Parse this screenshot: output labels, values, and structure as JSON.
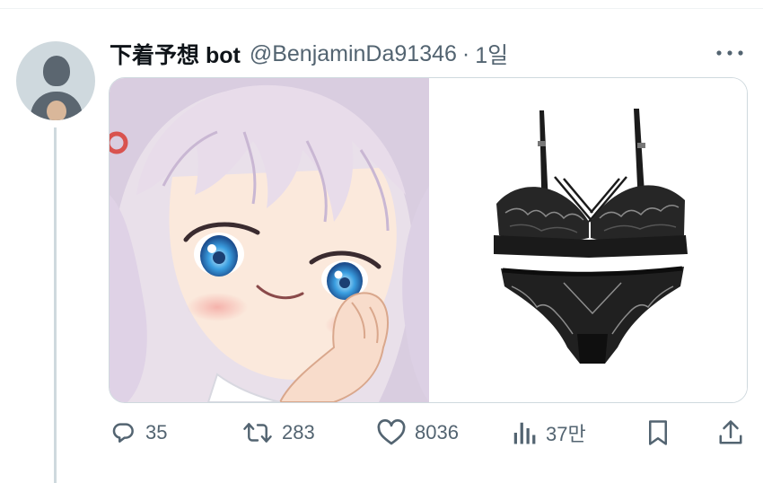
{
  "tweet": {
    "display_name": "下着予想 bot",
    "handle": "@BenjaminDa91346",
    "separator": "·",
    "time": "1일",
    "more_icon": "more-horizontal-icon",
    "media": [
      {
        "type": "image",
        "alt": "",
        "subject": "anime-girl-portrait"
      },
      {
        "type": "image",
        "alt": "",
        "subject": "black-lace-lingerie-set"
      }
    ],
    "actions": {
      "reply": {
        "icon": "reply-icon",
        "count": "35"
      },
      "retweet": {
        "icon": "retweet-icon",
        "count": "283"
      },
      "like": {
        "icon": "heart-icon",
        "count": "8036"
      },
      "views": {
        "icon": "analytics-icon",
        "count": "37만"
      },
      "bookmark": {
        "icon": "bookmark-icon"
      },
      "share": {
        "icon": "share-icon"
      }
    }
  },
  "colors": {
    "text": "#0f1419",
    "secondary": "#536471",
    "border": "#cfd9de"
  }
}
